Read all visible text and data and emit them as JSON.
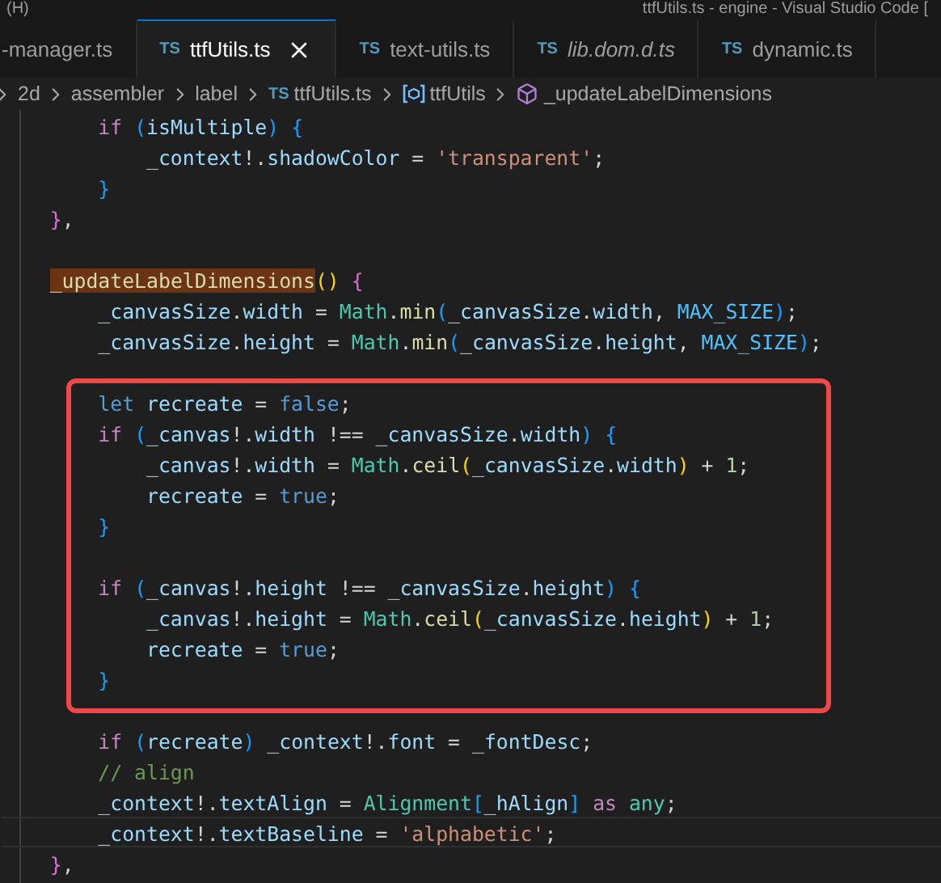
{
  "window": {
    "menu_fragment": "(H)",
    "title": "ttfUtils.ts - engine - Visual Studio Code ["
  },
  "tabs": [
    {
      "label": "-manager.ts",
      "selected": false,
      "preview": false
    },
    {
      "label": "ttfUtils.ts",
      "icon_text": "TS",
      "selected": true,
      "preview": false
    },
    {
      "label": "text-utils.ts",
      "icon_text": "TS",
      "selected": false,
      "preview": false
    },
    {
      "label": "lib.dom.d.ts",
      "icon_text": "TS",
      "selected": false,
      "preview": true
    },
    {
      "label": "dynamic.ts",
      "icon_text": "TS",
      "selected": false,
      "preview": false
    }
  ],
  "breadcrumb": [
    {
      "kind": "folder",
      "label": "2d"
    },
    {
      "kind": "folder",
      "label": "assembler"
    },
    {
      "kind": "folder",
      "label": "label"
    },
    {
      "kind": "file",
      "label": "ttfUtils.ts",
      "icon_text": "TS"
    },
    {
      "kind": "module",
      "label": "ttfUtils"
    },
    {
      "kind": "method",
      "label": "_updateLabelDimensions"
    }
  ],
  "lines": [
    {
      "kind": "code",
      "tokens": [
        {
          "text": "        if",
          "kind": "kw"
        },
        {
          "text": " (",
          "kind": "b3"
        },
        {
          "text": "isMultiple",
          "kind": "var"
        },
        {
          "text": ")",
          "kind": "b3"
        },
        {
          "text": " {",
          "kind": "b3"
        }
      ]
    },
    {
      "kind": "code",
      "tokens": [
        {
          "text": "            _context",
          "kind": "var"
        },
        {
          "text": "!.",
          "kind": "p"
        },
        {
          "text": "shadowColor",
          "kind": "var"
        },
        {
          "text": " = ",
          "kind": "p"
        },
        {
          "text": "'transparent'",
          "kind": "str"
        },
        {
          "text": ";",
          "kind": "p"
        }
      ]
    },
    {
      "kind": "code",
      "tokens": [
        {
          "text": "        }",
          "kind": "b3"
        }
      ]
    },
    {
      "kind": "code",
      "tokens": [
        {
          "text": "    }",
          "kind": "b2"
        },
        {
          "text": ",",
          "kind": "p"
        }
      ]
    },
    {
      "kind": "blank"
    },
    {
      "kind": "code",
      "tokens": [
        {
          "text": "    _updateLabelDimensions",
          "kind": "fn",
          "highlight": true
        },
        {
          "text": "()",
          "kind": "b1"
        },
        {
          "text": " {",
          "kind": "b2"
        }
      ]
    },
    {
      "kind": "code",
      "tokens": [
        {
          "text": "        _canvasSize",
          "kind": "var"
        },
        {
          "text": ".",
          "kind": "p"
        },
        {
          "text": "width",
          "kind": "var"
        },
        {
          "text": " = ",
          "kind": "p"
        },
        {
          "text": "Math",
          "kind": "type"
        },
        {
          "text": ".",
          "kind": "p"
        },
        {
          "text": "min",
          "kind": "fn"
        },
        {
          "text": "(",
          "kind": "b3"
        },
        {
          "text": "_canvasSize",
          "kind": "var"
        },
        {
          "text": ".",
          "kind": "p"
        },
        {
          "text": "width",
          "kind": "var"
        },
        {
          "text": ", ",
          "kind": "p"
        },
        {
          "text": "MAX_SIZE",
          "kind": "const"
        },
        {
          "text": ")",
          "kind": "b3"
        },
        {
          "text": ";",
          "kind": "p"
        }
      ]
    },
    {
      "kind": "code",
      "tokens": [
        {
          "text": "        _canvasSize",
          "kind": "var"
        },
        {
          "text": ".",
          "kind": "p"
        },
        {
          "text": "height",
          "kind": "var"
        },
        {
          "text": " = ",
          "kind": "p"
        },
        {
          "text": "Math",
          "kind": "type"
        },
        {
          "text": ".",
          "kind": "p"
        },
        {
          "text": "min",
          "kind": "fn"
        },
        {
          "text": "(",
          "kind": "b3"
        },
        {
          "text": "_canvasSize",
          "kind": "var"
        },
        {
          "text": ".",
          "kind": "p"
        },
        {
          "text": "height",
          "kind": "var"
        },
        {
          "text": ", ",
          "kind": "p"
        },
        {
          "text": "MAX_SIZE",
          "kind": "const"
        },
        {
          "text": ")",
          "kind": "b3"
        },
        {
          "text": ";",
          "kind": "p"
        }
      ]
    },
    {
      "kind": "blank"
    },
    {
      "kind": "code",
      "boxed": true,
      "tokens": [
        {
          "text": "        let",
          "kind": "kwb"
        },
        {
          "text": " recreate",
          "kind": "var"
        },
        {
          "text": " = ",
          "kind": "p"
        },
        {
          "text": "false",
          "kind": "kwb"
        },
        {
          "text": ";",
          "kind": "p"
        }
      ]
    },
    {
      "kind": "code",
      "boxed": true,
      "tokens": [
        {
          "text": "        if",
          "kind": "kw"
        },
        {
          "text": " (",
          "kind": "b3"
        },
        {
          "text": "_canvas",
          "kind": "var"
        },
        {
          "text": "!.",
          "kind": "p"
        },
        {
          "text": "width",
          "kind": "var"
        },
        {
          "text": " !== ",
          "kind": "p"
        },
        {
          "text": "_canvasSize",
          "kind": "var"
        },
        {
          "text": ".",
          "kind": "p"
        },
        {
          "text": "width",
          "kind": "var"
        },
        {
          "text": ")",
          "kind": "b3"
        },
        {
          "text": " {",
          "kind": "b3"
        }
      ]
    },
    {
      "kind": "code",
      "boxed": true,
      "tokens": [
        {
          "text": "            _canvas",
          "kind": "var"
        },
        {
          "text": "!.",
          "kind": "p"
        },
        {
          "text": "width",
          "kind": "var"
        },
        {
          "text": " = ",
          "kind": "p"
        },
        {
          "text": "Math",
          "kind": "type"
        },
        {
          "text": ".",
          "kind": "p"
        },
        {
          "text": "ceil",
          "kind": "fn"
        },
        {
          "text": "(",
          "kind": "b1"
        },
        {
          "text": "_canvasSize",
          "kind": "var"
        },
        {
          "text": ".",
          "kind": "p"
        },
        {
          "text": "width",
          "kind": "var"
        },
        {
          "text": ")",
          "kind": "b1"
        },
        {
          "text": " + ",
          "kind": "p"
        },
        {
          "text": "1",
          "kind": "num"
        },
        {
          "text": ";",
          "kind": "p"
        }
      ]
    },
    {
      "kind": "code",
      "boxed": true,
      "tokens": [
        {
          "text": "            recreate",
          "kind": "var"
        },
        {
          "text": " = ",
          "kind": "p"
        },
        {
          "text": "true",
          "kind": "kwb"
        },
        {
          "text": ";",
          "kind": "p"
        }
      ]
    },
    {
      "kind": "code",
      "boxed": true,
      "tokens": [
        {
          "text": "        }",
          "kind": "b3"
        }
      ]
    },
    {
      "kind": "blank",
      "boxed": true
    },
    {
      "kind": "code",
      "boxed": true,
      "tokens": [
        {
          "text": "        if",
          "kind": "kw"
        },
        {
          "text": " (",
          "kind": "b3"
        },
        {
          "text": "_canvas",
          "kind": "var"
        },
        {
          "text": "!.",
          "kind": "p"
        },
        {
          "text": "height",
          "kind": "var"
        },
        {
          "text": " !== ",
          "kind": "p"
        },
        {
          "text": "_canvasSize",
          "kind": "var"
        },
        {
          "text": ".",
          "kind": "p"
        },
        {
          "text": "height",
          "kind": "var"
        },
        {
          "text": ")",
          "kind": "b3"
        },
        {
          "text": " {",
          "kind": "b3"
        }
      ]
    },
    {
      "kind": "code",
      "boxed": true,
      "tokens": [
        {
          "text": "            _canvas",
          "kind": "var"
        },
        {
          "text": "!.",
          "kind": "p"
        },
        {
          "text": "height",
          "kind": "var"
        },
        {
          "text": " = ",
          "kind": "p"
        },
        {
          "text": "Math",
          "kind": "type"
        },
        {
          "text": ".",
          "kind": "p"
        },
        {
          "text": "ceil",
          "kind": "fn"
        },
        {
          "text": "(",
          "kind": "b1"
        },
        {
          "text": "_canvasSize",
          "kind": "var"
        },
        {
          "text": ".",
          "kind": "p"
        },
        {
          "text": "height",
          "kind": "var"
        },
        {
          "text": ")",
          "kind": "b1"
        },
        {
          "text": " + ",
          "kind": "p"
        },
        {
          "text": "1",
          "kind": "num"
        },
        {
          "text": ";",
          "kind": "p"
        }
      ]
    },
    {
      "kind": "code",
      "boxed": true,
      "tokens": [
        {
          "text": "            recreate",
          "kind": "var"
        },
        {
          "text": " = ",
          "kind": "p"
        },
        {
          "text": "true",
          "kind": "kwb"
        },
        {
          "text": ";",
          "kind": "p"
        }
      ]
    },
    {
      "kind": "code",
      "boxed": true,
      "tokens": [
        {
          "text": "        }",
          "kind": "b3"
        }
      ]
    },
    {
      "kind": "blank"
    },
    {
      "kind": "code",
      "tokens": [
        {
          "text": "        if",
          "kind": "kw"
        },
        {
          "text": " (",
          "kind": "b3"
        },
        {
          "text": "recreate",
          "kind": "var"
        },
        {
          "text": ")",
          "kind": "b3"
        },
        {
          "text": " _context",
          "kind": "var"
        },
        {
          "text": "!.",
          "kind": "p"
        },
        {
          "text": "font",
          "kind": "var"
        },
        {
          "text": " = ",
          "kind": "p"
        },
        {
          "text": "_fontDesc",
          "kind": "var"
        },
        {
          "text": ";",
          "kind": "p"
        }
      ]
    },
    {
      "kind": "code",
      "tokens": [
        {
          "text": "        // align",
          "kind": "cmt"
        }
      ]
    },
    {
      "kind": "code",
      "tokens": [
        {
          "text": "        _context",
          "kind": "var"
        },
        {
          "text": "!.",
          "kind": "p"
        },
        {
          "text": "textAlign",
          "kind": "var"
        },
        {
          "text": " = ",
          "kind": "p"
        },
        {
          "text": "Alignment",
          "kind": "type"
        },
        {
          "text": "[",
          "kind": "b3"
        },
        {
          "text": "_hAlign",
          "kind": "var"
        },
        {
          "text": "]",
          "kind": "b3"
        },
        {
          "text": " as",
          "kind": "kw"
        },
        {
          "text": " any",
          "kind": "type"
        },
        {
          "text": ";",
          "kind": "p"
        }
      ]
    },
    {
      "kind": "code",
      "current": true,
      "tokens": [
        {
          "text": "        _context",
          "kind": "var"
        },
        {
          "text": "!.",
          "kind": "p"
        },
        {
          "text": "textBaseline",
          "kind": "var"
        },
        {
          "text": " = ",
          "kind": "p"
        },
        {
          "text": "'alphabetic'",
          "kind": "str"
        },
        {
          "text": ";",
          "kind": "p"
        }
      ]
    },
    {
      "kind": "code",
      "tokens": [
        {
          "text": "    }",
          "kind": "b2"
        },
        {
          "text": ",",
          "kind": "p"
        }
      ]
    }
  ]
}
